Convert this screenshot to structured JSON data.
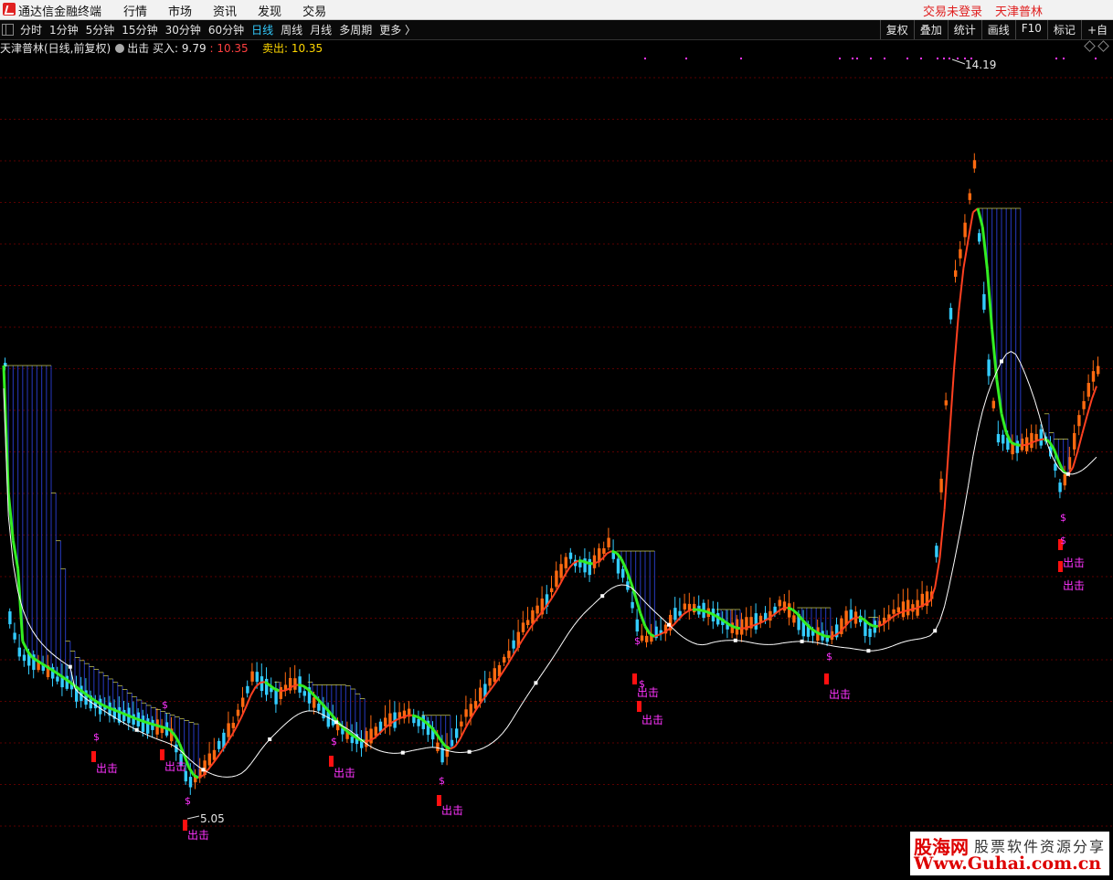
{
  "app": {
    "title": "通达信金融终端",
    "menu": [
      "行情",
      "市场",
      "资讯",
      "发现",
      "交易"
    ],
    "login_status": "交易未登录",
    "user": "天津普林"
  },
  "toolbar": {
    "periods": [
      "分时",
      "1分钟",
      "5分钟",
      "15分钟",
      "30分钟",
      "60分钟",
      "日线",
      "周线",
      "月线",
      "多周期",
      "更多 〉"
    ],
    "active_period": "日线",
    "right_tools": [
      "复权",
      "叠加",
      "统计",
      "画线",
      "F10",
      "标记",
      "+自"
    ]
  },
  "indicator_header": {
    "stock_label": "天津普林(日线,前复权)",
    "indicator_name": "出击",
    "buy_label": "买入:",
    "buy_value": "9.79",
    "buy_value2": "10.35",
    "sell_label": "卖出:",
    "sell_value": "10.35"
  },
  "chart_data": {
    "type": "candlestick",
    "high_marker": "14.19",
    "low_marker": "5.05",
    "signal_text": "出击",
    "signal_symbol": "$",
    "colors": {
      "up": "#ff6a10",
      "down": "#33ccff",
      "rising_line": "#ff4020",
      "falling_line": "#33ee22",
      "slow_line": "#ffffff",
      "fill": "#2030a0",
      "signal": "#ff33ff",
      "signal_bar": "#ff1010",
      "grid": "#5a0000"
    }
  },
  "watermark": {
    "brand": "股海网",
    "slogan": "股票软件资源分享",
    "url": "Www.Guhai.com.cn"
  }
}
